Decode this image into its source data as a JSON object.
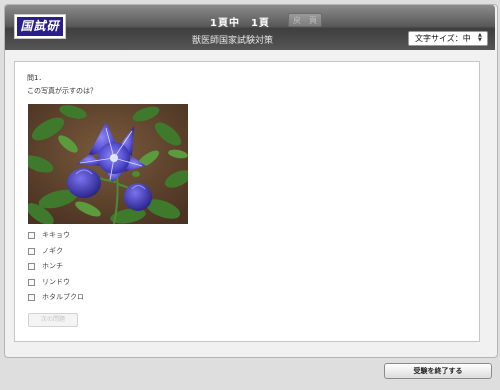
{
  "header": {
    "logo_text": "国試研",
    "page_indicator": "1頁中　1頁",
    "prev_label": "戻　頁",
    "subtitle": "獣医師国家試験対策",
    "font_size_label": "文字サイズ：中"
  },
  "question": {
    "number": "問1．",
    "text": "この写真が示すのは？",
    "image_icon": "bellflower-photo",
    "choices": [
      {
        "label": "キキョウ",
        "checked": false
      },
      {
        "label": "ノギク",
        "checked": false
      },
      {
        "label": "ホンチ",
        "checked": false
      },
      {
        "label": "リンドウ",
        "checked": false
      },
      {
        "label": "ホタルブクロ",
        "checked": false
      }
    ],
    "next_label": "次の問題"
  },
  "footer": {
    "finish_label": "受験を終了する"
  },
  "colors": {
    "header_dark": "#3f3f3f",
    "logo_bg": "#2a1f8a",
    "flower": "#4a44c8"
  }
}
